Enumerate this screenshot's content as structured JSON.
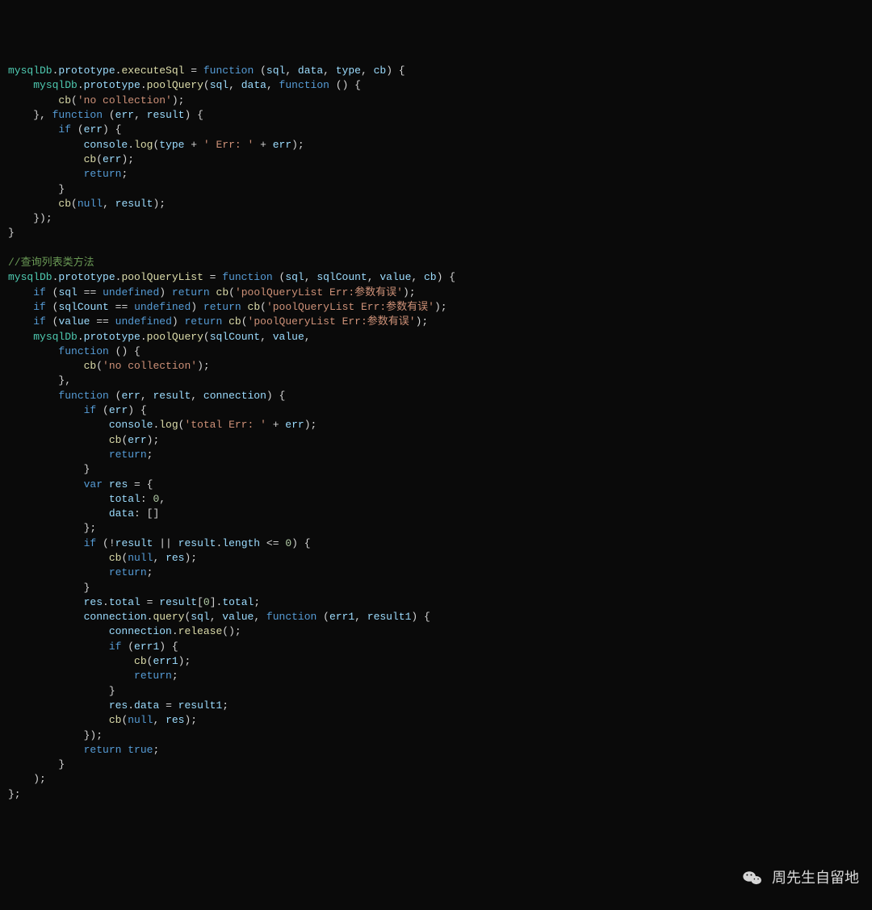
{
  "code": {
    "obj": "mysqlDb",
    "proto": "prototype",
    "fn_executeSql": "executeSql",
    "fn_poolQuery": "poolQuery",
    "fn_poolQueryList": "poolQueryList",
    "fn_cb": "cb",
    "fn_log": "log",
    "fn_query": "query",
    "fn_release": "release",
    "kw_function": "function",
    "kw_if": "if",
    "kw_return": "return",
    "kw_var": "var",
    "kw_null": "null",
    "kw_true": "true",
    "kw_undefined": "undefined",
    "p_sql": "sql",
    "p_data": "data",
    "p_type": "type",
    "p_err": "err",
    "p_err1": "err1",
    "p_result": "result",
    "p_result1": "result1",
    "p_connection": "connection",
    "p_sqlCount": "sqlCount",
    "p_value": "value",
    "p_res": "res",
    "p_total": "total",
    "p_length": "length",
    "p_console": "console",
    "s_no_collection": "'no collection'",
    "s_err_pref": "' Err: '",
    "s_total_err": "'total Err: '",
    "s_pql_err1": "'poolQueryList Err:参数有误'",
    "s_pql_err2": "'poolQueryList Err:参数有误'",
    "s_pql_err3": "'poolQueryList Err:参数有误'",
    "n_zero": "0",
    "comment_list": "//查询列表类方法",
    "empty_arr": "[]"
  },
  "watermark": {
    "text": "周先生自留地"
  }
}
